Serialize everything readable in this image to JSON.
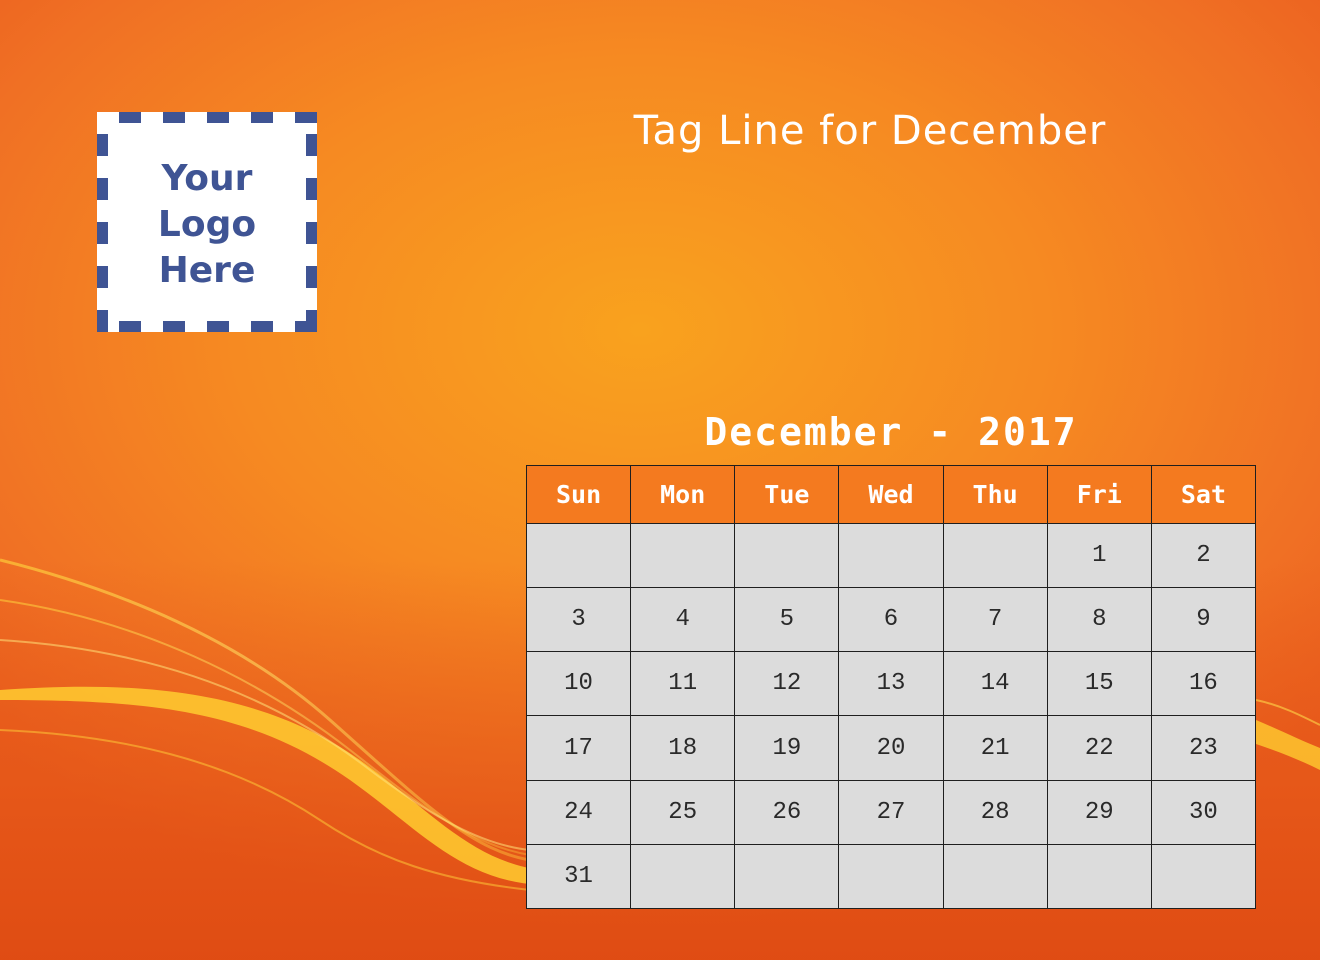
{
  "logo": {
    "lines": [
      "Your",
      "Logo",
      "Here"
    ]
  },
  "tagline": "Tag Line for December",
  "calendar": {
    "title": "December - 2017",
    "weekdays": [
      "Sun",
      "Mon",
      "Tue",
      "Wed",
      "Thu",
      "Fri",
      "Sat"
    ],
    "weeks": [
      [
        "",
        "",
        "",
        "",
        "",
        "1",
        "2"
      ],
      [
        "3",
        "4",
        "5",
        "6",
        "7",
        "8",
        "9"
      ],
      [
        "10",
        "11",
        "12",
        "13",
        "14",
        "15",
        "16"
      ],
      [
        "17",
        "18",
        "19",
        "20",
        "21",
        "22",
        "23"
      ],
      [
        "24",
        "25",
        "26",
        "27",
        "28",
        "29",
        "30"
      ],
      [
        "31",
        "",
        "",
        "",
        "",
        "",
        ""
      ]
    ]
  },
  "colors": {
    "background": "#f68a22",
    "header": "#f47a1f",
    "cell": "#dcdcdc",
    "logo_frame": "#3f5494"
  }
}
